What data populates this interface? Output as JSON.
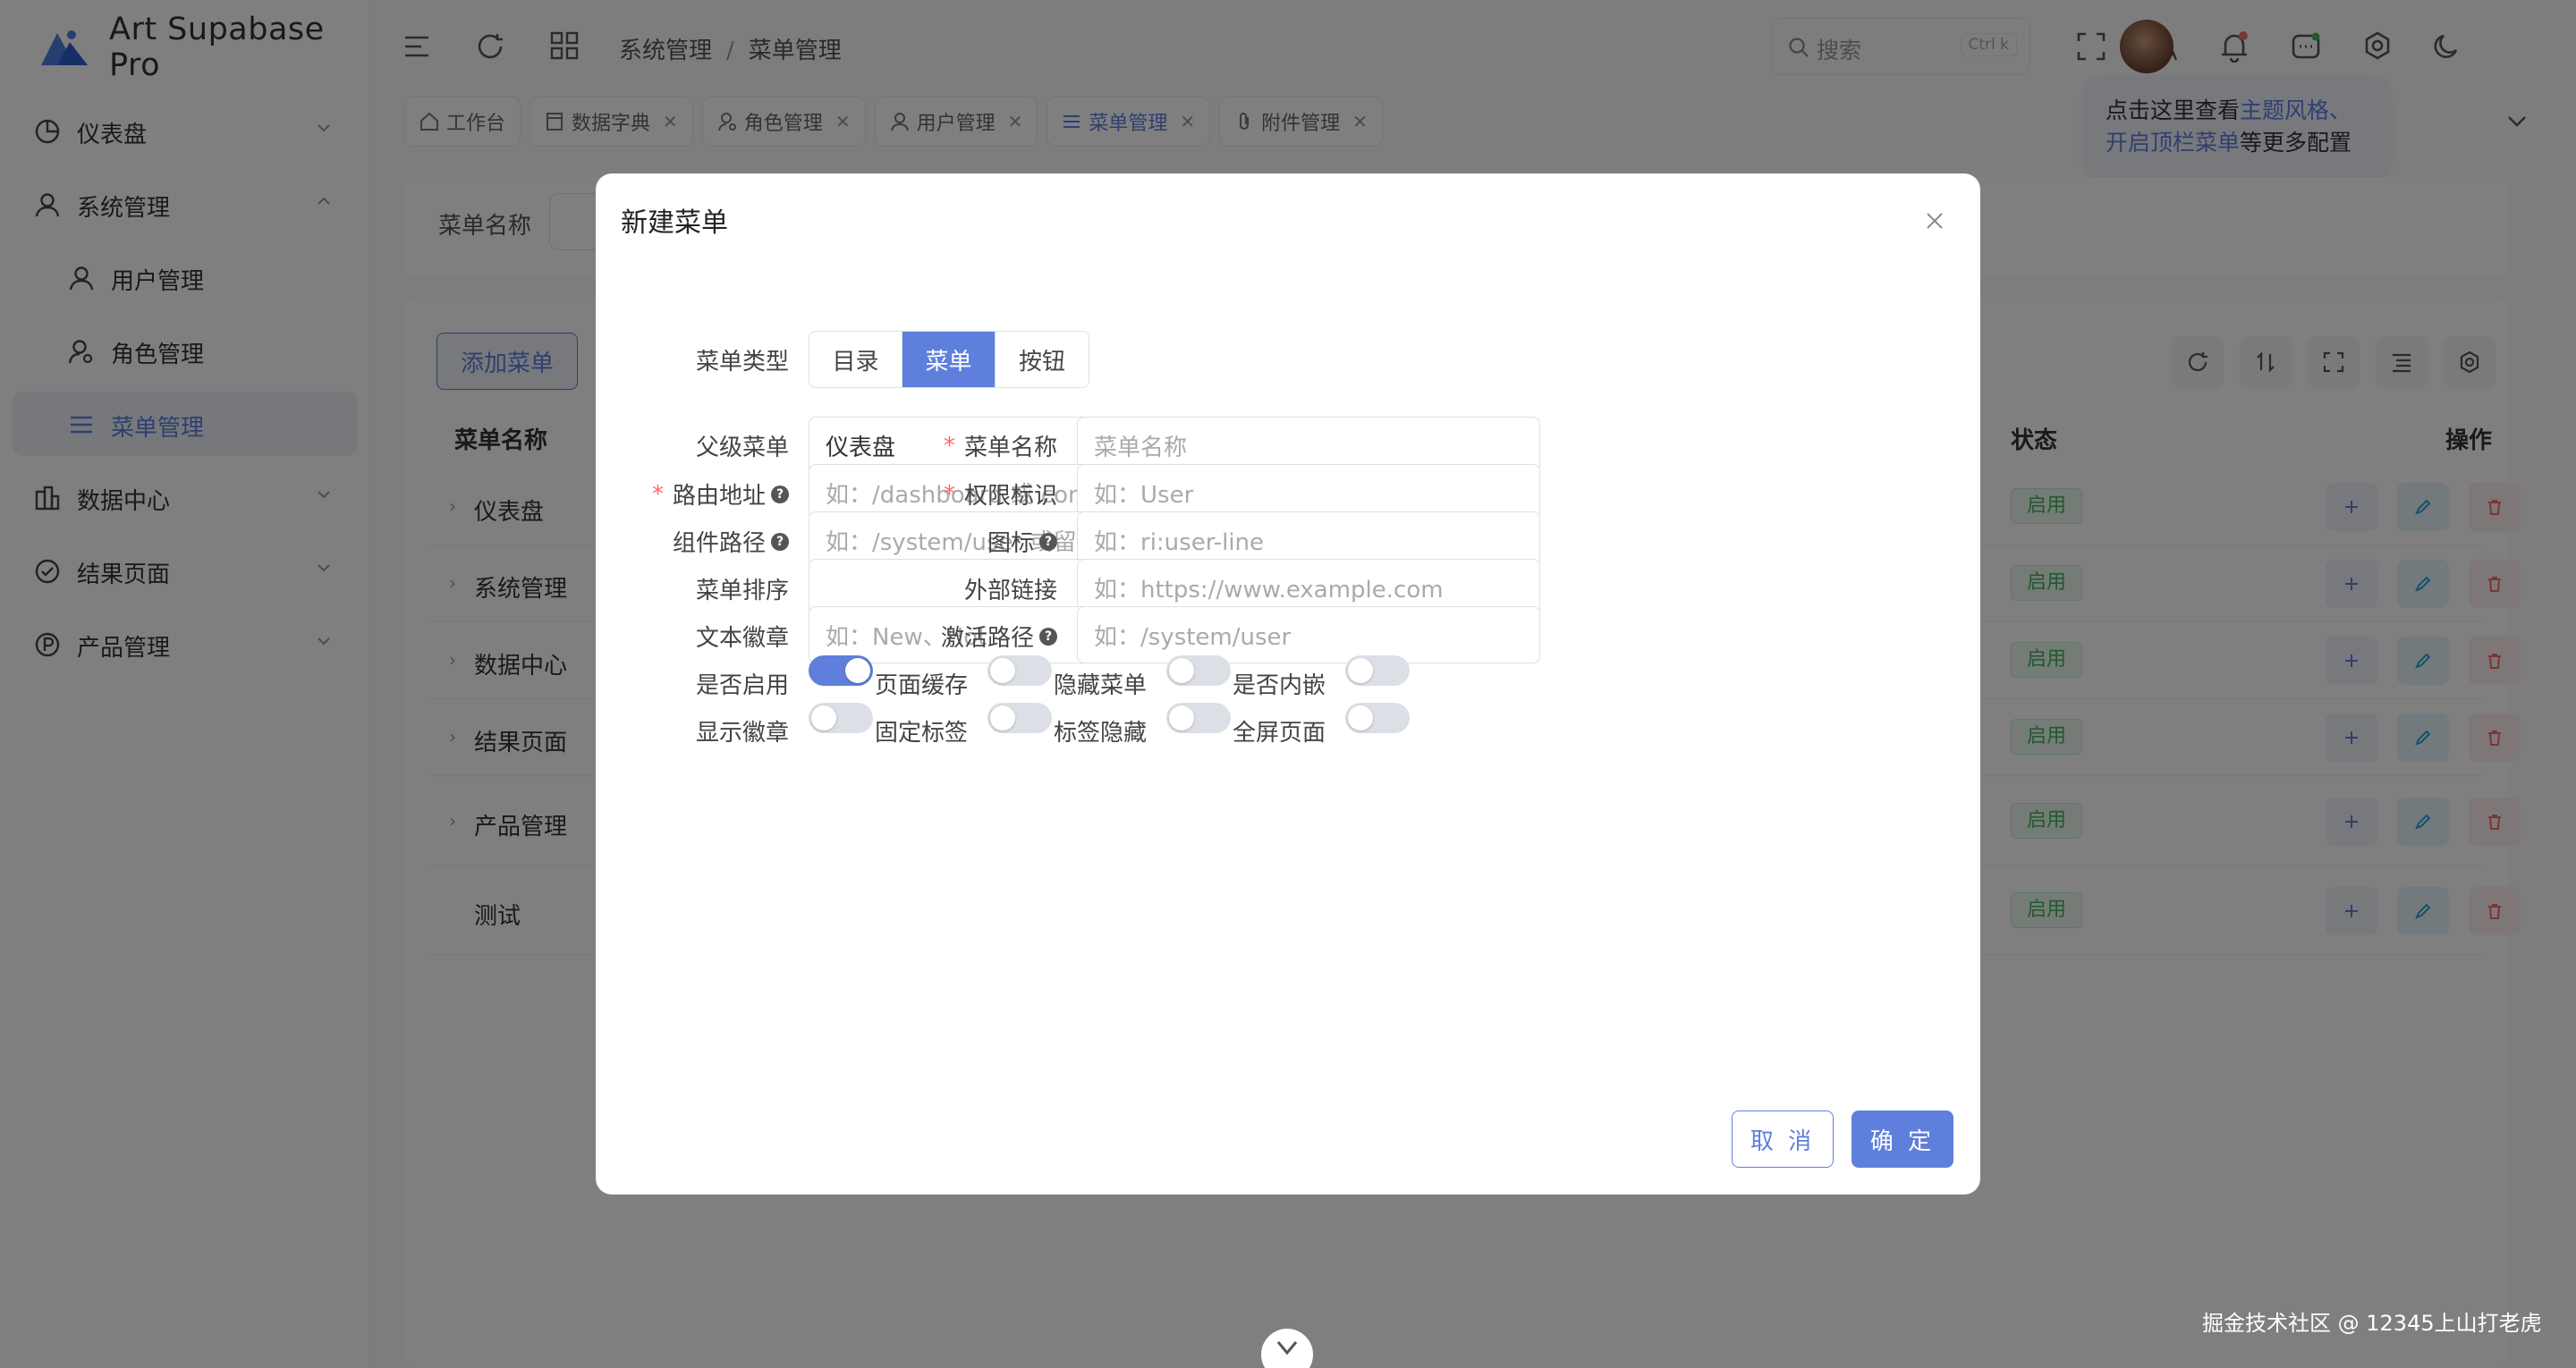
{
  "app": {
    "name": "Art Supabase Pro"
  },
  "sidebar": {
    "items": [
      {
        "label": "仪表盘",
        "icon": "dashboard-icon"
      },
      {
        "label": "系统管理",
        "icon": "user-icon"
      },
      {
        "label": "用户管理",
        "icon": "user-icon"
      },
      {
        "label": "角色管理",
        "icon": "user-role-icon"
      },
      {
        "label": "菜单管理",
        "icon": "menu-list-icon"
      },
      {
        "label": "数据中心",
        "icon": "chart-icon"
      },
      {
        "label": "结果页面",
        "icon": "check-circle-icon"
      },
      {
        "label": "产品管理",
        "icon": "product-icon"
      }
    ]
  },
  "header": {
    "breadcrumb": [
      "系统管理",
      "菜单管理"
    ],
    "search_placeholder": "搜索",
    "search_shortcut": "Ctrl k"
  },
  "tip": {
    "part1": "点击这里查看",
    "link1": "主题风格、",
    "link2": "开启顶栏菜单",
    "part2": "等更多配置"
  },
  "tabs": [
    {
      "label": "工作台",
      "closable": false
    },
    {
      "label": "数据字典",
      "closable": true
    },
    {
      "label": "角色管理",
      "closable": true
    },
    {
      "label": "用户管理",
      "closable": true
    },
    {
      "label": "菜单管理",
      "closable": true,
      "active": true
    },
    {
      "label": "附件管理",
      "closable": true
    }
  ],
  "filter": {
    "label": "菜单名称"
  },
  "table": {
    "add_button": "添加菜单",
    "headers": {
      "name": "菜单名称",
      "status": "状态",
      "actions": "操作"
    },
    "rows": [
      {
        "name": "仪表盘",
        "status": "启用",
        "expandable": true
      },
      {
        "name": "系统管理",
        "status": "启用",
        "expandable": true
      },
      {
        "name": "数据中心",
        "status": "启用",
        "expandable": true
      },
      {
        "name": "结果页面",
        "status": "启用",
        "expandable": true
      },
      {
        "name": "产品管理",
        "status": "启用",
        "expandable": true
      },
      {
        "name": "测试",
        "status": "启用",
        "expandable": false
      }
    ]
  },
  "dialog": {
    "title": "新建菜单",
    "menu_type": {
      "label": "菜单类型",
      "options": [
        "目录",
        "菜单",
        "按钮"
      ],
      "selected": "菜单"
    },
    "fields": {
      "parent": {
        "label": "父级菜单",
        "value": "仪表盘"
      },
      "name": {
        "label": "菜单名称",
        "placeholder": "菜单名称"
      },
      "route": {
        "label": "路由地址",
        "placeholder": "如：/dashboard 或 console"
      },
      "permission": {
        "label": "权限标识",
        "placeholder": "如：User"
      },
      "component": {
        "label": "组件路径",
        "placeholder": "如：/system/user 或留空"
      },
      "icon": {
        "label": "图标",
        "placeholder": "如：ri:user-line"
      },
      "sort": {
        "label": "菜单排序",
        "value": ""
      },
      "external": {
        "label": "外部链接",
        "placeholder": "如：https://www.example.com"
      },
      "badge_text": {
        "label": "文本徽章",
        "placeholder": "如：New、Hot"
      },
      "active_path": {
        "label": "激活路径",
        "placeholder": "如：/system/user"
      }
    },
    "switches": [
      {
        "label": "是否启用",
        "on": true
      },
      {
        "label": "页面缓存",
        "on": false
      },
      {
        "label": "隐藏菜单",
        "on": false
      },
      {
        "label": "是否内嵌",
        "on": false
      },
      {
        "label": "显示徽章",
        "on": false
      },
      {
        "label": "固定标签",
        "on": false
      },
      {
        "label": "标签隐藏",
        "on": false
      },
      {
        "label": "全屏页面",
        "on": false
      }
    ],
    "cancel": "取 消",
    "confirm": "确 定"
  },
  "watermark": "掘金技术社区 @ 12345上山打老虎",
  "colors": {
    "accent": "#5e7fdc",
    "success": "#43b05c",
    "danger": "#f56c6c"
  }
}
